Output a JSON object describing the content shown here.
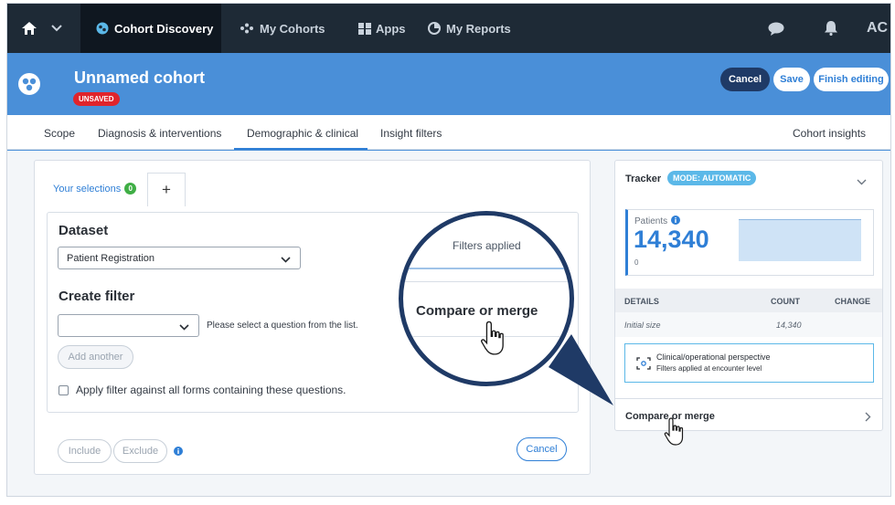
{
  "nav": {
    "items": [
      {
        "label": "",
        "icon": "home-icon"
      },
      {
        "label": "",
        "icon": "chevron-down-icon"
      },
      {
        "label": "Cohort Discovery",
        "icon": "cohort-discovery-icon"
      },
      {
        "label": "My Cohorts",
        "icon": "my-cohorts-icon"
      },
      {
        "label": "Apps",
        "icon": "apps-grid-icon"
      },
      {
        "label": "My Reports",
        "icon": "reports-pie-icon"
      }
    ],
    "right": {
      "chat_icon": "chat-bubble-icon",
      "bell_icon": "bell-icon",
      "user_initials": "AC"
    }
  },
  "header": {
    "title": "Unnamed cohort",
    "badge": "UNSAVED",
    "buttons": {
      "cancel": "Cancel",
      "save": "Save",
      "finish": "Finish editing"
    }
  },
  "tabs": {
    "items": [
      "Scope",
      "Diagnosis & interventions",
      "Demographic & clinical",
      "Insight filters"
    ],
    "active": "Demographic & clinical",
    "right": "Cohort insights"
  },
  "left_panel": {
    "selections_label": "Your selections",
    "selections_count": "0",
    "plus_label": "+",
    "dataset_heading": "Dataset",
    "dataset_value": "Patient Registration",
    "filters_applied": "Filters applied",
    "create_filter_heading": "Create filter",
    "question_value": "",
    "question_hint": "Please select a question from the list.",
    "add_another": "Add another",
    "apply_all_forms": "Apply filter against all forms containing these questions.",
    "include": "Include",
    "exclude": "Exclude",
    "cancel": "Cancel"
  },
  "tracker": {
    "title": "Tracker",
    "mode": "MODE: AUTOMATIC",
    "patients_label": "Patients",
    "patients_value": "14,340",
    "axis_zero": "0",
    "details_headers": {
      "details": "DETAILS",
      "count": "COUNT",
      "change": "CHANGE"
    },
    "initial_row": {
      "label": "Initial size",
      "count": "14,340"
    },
    "perspective_line1": "Clinical/operational perspective",
    "perspective_line2": "Filters applied at encounter level",
    "compare_label": "Compare or merge"
  },
  "zoom": {
    "filters_applied": "Filters applied",
    "compare_label": "Compare or merge"
  }
}
